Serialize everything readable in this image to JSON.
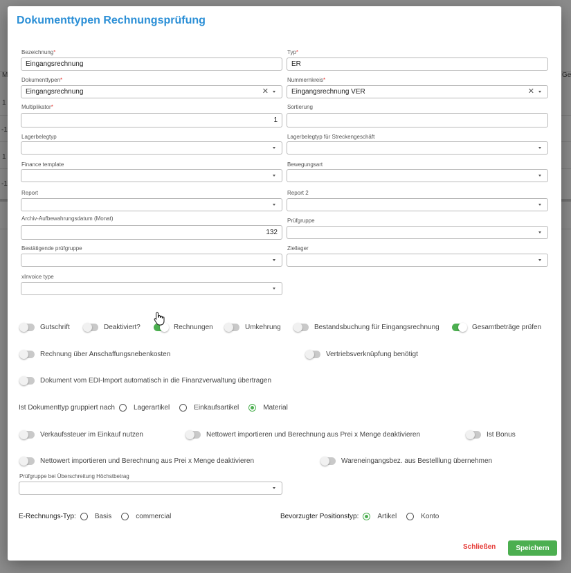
{
  "dialog": {
    "title": "Dokumenttypen Rechnungsprüfung"
  },
  "fields": {
    "bezeichnung": {
      "label": "Bezeichnung",
      "required": "*",
      "value": "Eingangsrechnung"
    },
    "typ": {
      "label": "Typ",
      "required": "*",
      "value": "ER"
    },
    "dokumenttypen": {
      "label": "Dokumenttypen",
      "required": "*",
      "value": "Eingangsrechnung"
    },
    "nummernkreis": {
      "label": "Nummernkreis",
      "required": "*",
      "value": "Eingangsrechnung VER"
    },
    "multiplikator": {
      "label": "Multiplikator",
      "required": "*",
      "value": "1"
    },
    "sortierung": {
      "label": "Sortierung",
      "value": ""
    },
    "lagerbelegtyp": {
      "label": "Lagerbelegtyp",
      "value": ""
    },
    "lagerbelegtyp_strecke": {
      "label": "Lagerbelegtyp für Streckengeschäft",
      "value": ""
    },
    "finance_template": {
      "label": "Finance template",
      "value": ""
    },
    "bewegungsart": {
      "label": "Bewegungsart",
      "value": ""
    },
    "report": {
      "label": "Report",
      "value": ""
    },
    "report2": {
      "label": "Report 2",
      "value": ""
    },
    "archiv": {
      "label": "Archiv-Aufbewahrungsdatum (Monat)",
      "value": "132"
    },
    "pruefgruppe": {
      "label": "Prüfgruppe",
      "value": ""
    },
    "bestaetigende": {
      "label": "Bestätigende prüfgruppe",
      "value": ""
    },
    "ziellager": {
      "label": "Ziellager",
      "value": ""
    },
    "xinvoice": {
      "label": "xInvoice type",
      "value": ""
    },
    "pruefgruppe_hoechst": {
      "label": "Prüfgruppe bei Überschreitung Höchstbetrag",
      "value": ""
    }
  },
  "toggles": {
    "gutschrift": {
      "label": "Gutschrift",
      "on": false
    },
    "deaktiviert": {
      "label": "Deaktiviert?",
      "on": false
    },
    "rechnungen": {
      "label": "Rechnungen",
      "on": true
    },
    "umkehrung": {
      "label": "Umkehrung",
      "on": false
    },
    "bestandsbuchung": {
      "label": "Bestandsbuchung für Eingangsrechnung",
      "on": false
    },
    "gesamtbetraege": {
      "label": "Gesamtbeträge prüfen",
      "on": true
    },
    "anschaffung": {
      "label": "Rechnung über Anschaffungsnebenkosten",
      "on": false
    },
    "vertrieb": {
      "label": "Vertriebsverknüpfung benötigt",
      "on": false
    },
    "edi": {
      "label": "Dokument vom EDI-Import automatisch in die Finanzverwaltung übertragen",
      "on": false
    },
    "verkaufssteuer": {
      "label": "Verkaufssteuer im Einkauf nutzen",
      "on": false
    },
    "nettowert1": {
      "label": "Nettowert importieren und Berechnung aus Prei x Menge deaktivieren",
      "on": false
    },
    "bonus": {
      "label": "Ist Bonus",
      "on": false
    },
    "nettowert2": {
      "label": "Nettowert importieren und Berechnung aus Prei x Menge deaktivieren",
      "on": false
    },
    "wareneingang": {
      "label": "Wareneingangsbez. aus Bestelllung übernehmen",
      "on": false
    }
  },
  "radios": {
    "gruppiert": {
      "label": "Ist Dokumenttyp gruppiert nach",
      "options": [
        "Lagerartikel",
        "Einkaufsartikel",
        "Material"
      ],
      "selected": "Material"
    },
    "erechnung": {
      "label": "E-Rechnungs-Typ:",
      "options": [
        "Basis",
        "commercial"
      ],
      "selected": ""
    },
    "positionstyp": {
      "label": "Bevorzugter Positionstyp:",
      "options": [
        "Artikel",
        "Konto"
      ],
      "selected": "Artikel"
    }
  },
  "buttons": {
    "close": "Schließen",
    "save": "Speichern"
  },
  "background": {
    "col_m": "M",
    "col_ge": "Ge",
    "row1": "1",
    "row2": "-1",
    "row3": "1",
    "row4": "-1"
  },
  "colors": {
    "accent": "#2b8fd6",
    "success": "#4caf50",
    "danger": "#e53935"
  }
}
